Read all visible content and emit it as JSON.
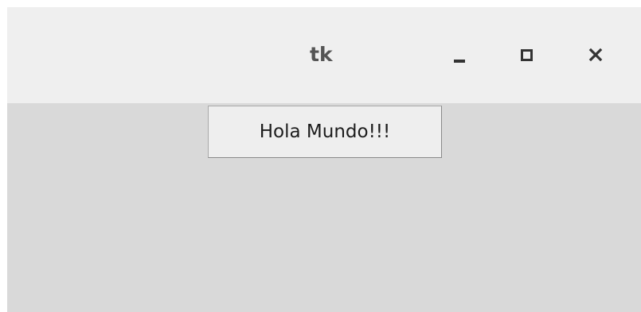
{
  "window": {
    "title": "tk",
    "controls": {
      "minimize_icon": "minimize-icon",
      "maximize_icon": "maximize-icon",
      "close_icon": "close-icon",
      "close_glyph": "✕"
    }
  },
  "main": {
    "button_label": "Hola Mundo!!!"
  },
  "colors": {
    "titlebar_bg": "#efefef",
    "client_bg": "#d9d9d9",
    "button_bg": "#eeeeee",
    "title_text": "#555555"
  }
}
